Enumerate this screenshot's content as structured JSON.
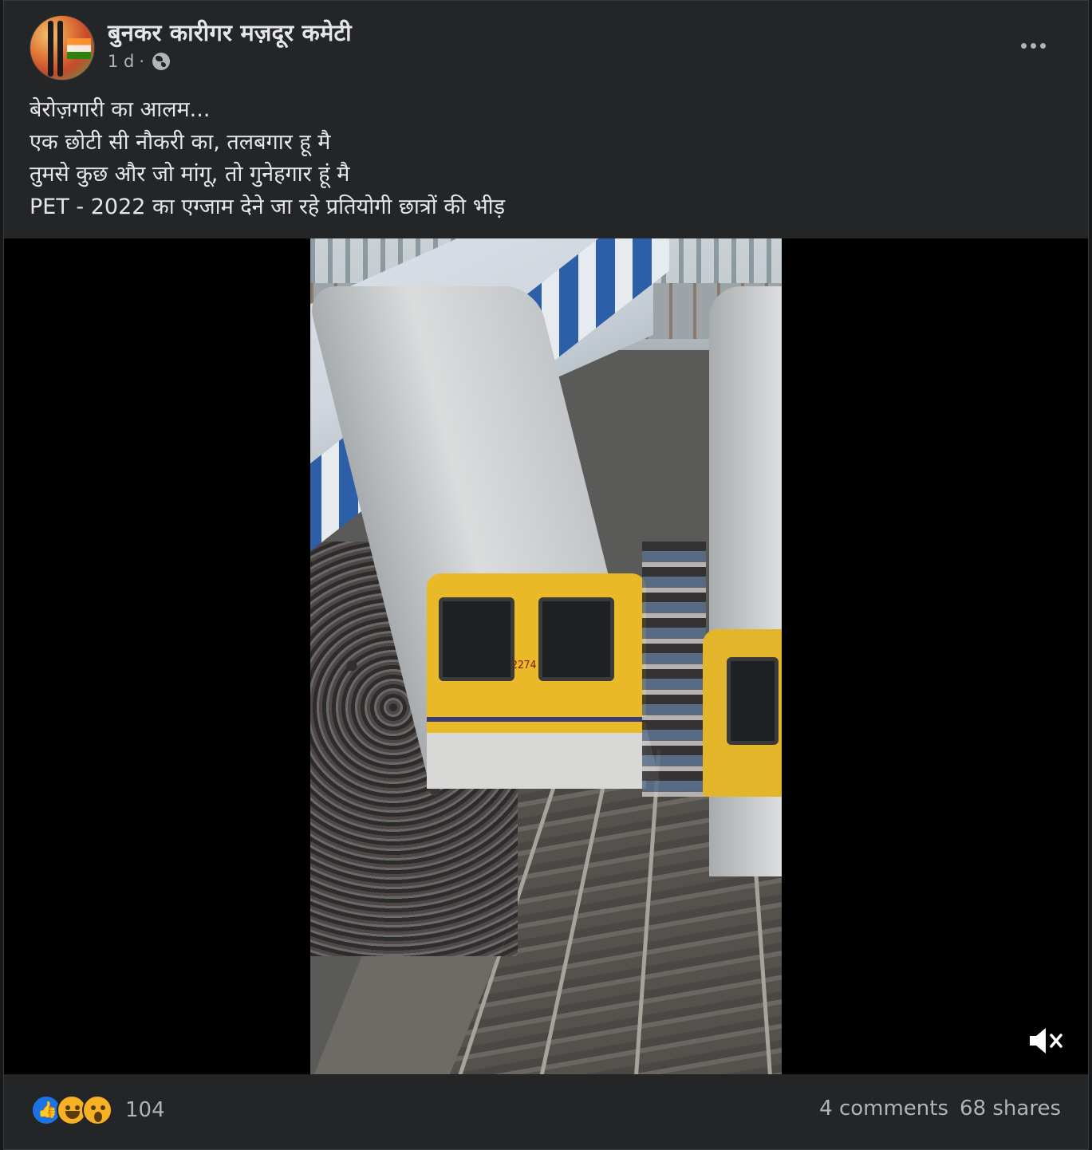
{
  "post": {
    "page_name": "बुनकर कारीगर मज़दूर कमेटी",
    "time": "1 d",
    "separator": "·",
    "audience_icon": "globe-icon",
    "more_icon": "more-horizontal-icon",
    "text_lines": [
      "बेरोज़गारी का आलम...",
      "एक छोटी सी नौकरी का, तलबगार हू मै",
      "तुमसे कुछ और जो मांगू, तो गुनेहगार हूं मै",
      "PET - 2022 का एग्जाम देने जा रहे प्रतियोगी छात्रों की भीड़"
    ],
    "video": {
      "train_number": "2274",
      "mute_icon": "volume-muted-icon"
    },
    "reactions": {
      "icons": [
        "like-icon",
        "haha-icon",
        "wow-icon"
      ],
      "count": "104"
    },
    "stats": {
      "comments": "4 comments",
      "shares": "68 shares"
    }
  }
}
